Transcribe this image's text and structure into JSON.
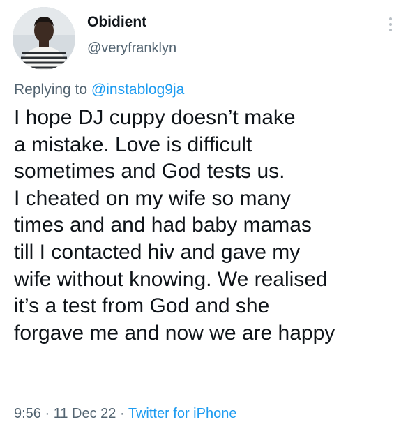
{
  "user": {
    "display_name": "Obidient",
    "handle": "@veryfranklyn",
    "avatar_icon": "profile-photo-avatar"
  },
  "menu": {
    "icon": "more-options-icon"
  },
  "reply": {
    "prefix": "Replying to ",
    "mention": "@instablog9ja"
  },
  "tweet": {
    "lines": [
      "I hope DJ cuppy doesn’t make",
      "a mistake. Love is difficult",
      "sometimes and God tests us.",
      "I cheated on my wife so many",
      "times and and had baby mamas",
      "till I contacted hiv and gave my",
      "wife without knowing. We realised",
      "it’s a test from God and she",
      "forgave me and now we are happy"
    ]
  },
  "meta": {
    "time": "9:56",
    "sep1": " · ",
    "date": "11 Dec 22",
    "sep2": " · ",
    "source": "Twitter for iPhone"
  },
  "colors": {
    "text": "#0f1419",
    "secondary": "#536471",
    "link": "#1d9bf0"
  }
}
